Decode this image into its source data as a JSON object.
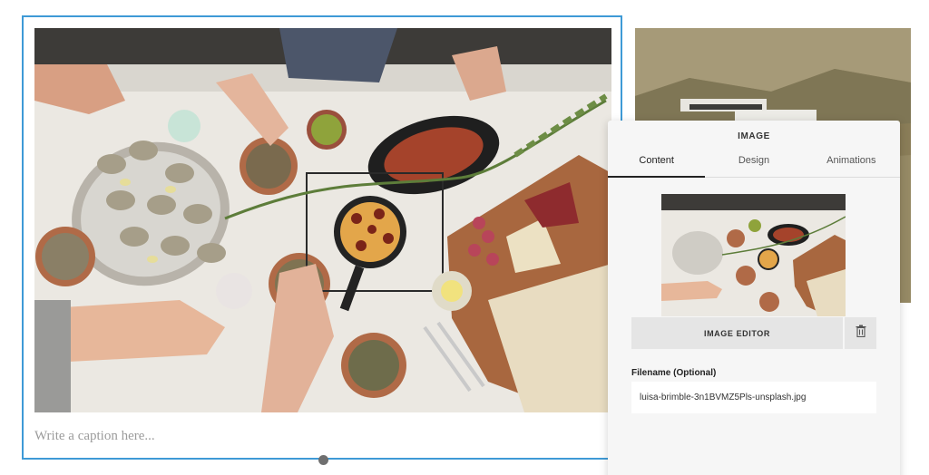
{
  "block": {
    "caption_placeholder": "Write a caption here..."
  },
  "panel": {
    "title": "IMAGE",
    "tabs": [
      {
        "label": "Content",
        "active": true
      },
      {
        "label": "Design",
        "active": false
      },
      {
        "label": "Animations",
        "active": false
      }
    ],
    "image_editor_label": "IMAGE EDITOR",
    "trash_icon": "trash-icon",
    "filename_label": "Filename (Optional)",
    "filename_value": "luisa-brimble-3n1BVMZ5Pls-unsplash.jpg"
  },
  "colors": {
    "selection_border": "#3e9ad6",
    "panel_bg": "#f6f6f6"
  }
}
